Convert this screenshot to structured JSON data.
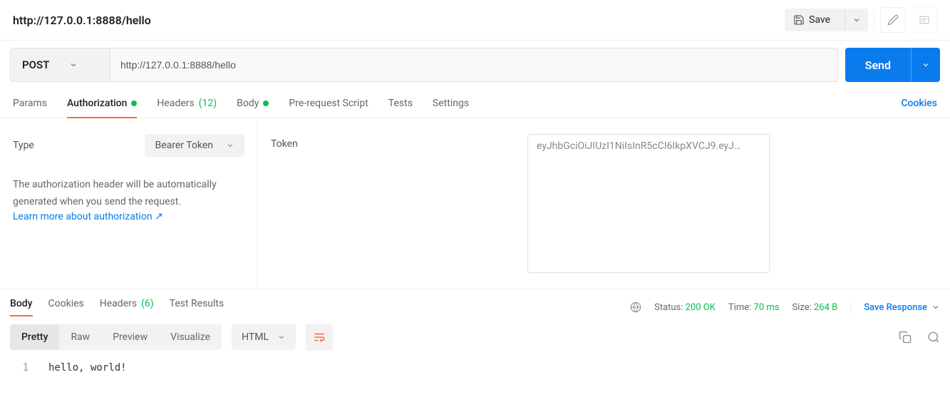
{
  "header": {
    "title": "http://127.0.0.1:8888/hello",
    "save_label": "Save"
  },
  "request": {
    "method": "POST",
    "url": "http://127.0.0.1:8888/hello",
    "send_label": "Send"
  },
  "tabs": {
    "params": "Params",
    "authorization": "Authorization",
    "headers": "Headers",
    "headers_count": "(12)",
    "body": "Body",
    "prerequest": "Pre-request Script",
    "tests": "Tests",
    "settings": "Settings",
    "cookies": "Cookies"
  },
  "auth": {
    "type_label": "Type",
    "type_value": "Bearer Token",
    "helper": "The authorization header will be automatically generated when you send the request.",
    "learn": "Learn more about authorization ↗",
    "token_label": "Token",
    "token_value": "eyJhbGciOiJIUzI1NiIsInR5cCI6IkpXVCJ9.eyJ…"
  },
  "response": {
    "tabs": {
      "body": "Body",
      "cookies": "Cookies",
      "headers": "Headers",
      "headers_count": "(6)",
      "test_results": "Test Results"
    },
    "status_label": "Status:",
    "status_value": "200 OK",
    "time_label": "Time:",
    "time_value": "70 ms",
    "size_label": "Size:",
    "size_value": "264 B",
    "save_response": "Save Response"
  },
  "viewer": {
    "pretty": "Pretty",
    "raw": "Raw",
    "preview": "Preview",
    "visualize": "Visualize",
    "format": "HTML",
    "line_num": "1",
    "content": "hello, world!"
  }
}
